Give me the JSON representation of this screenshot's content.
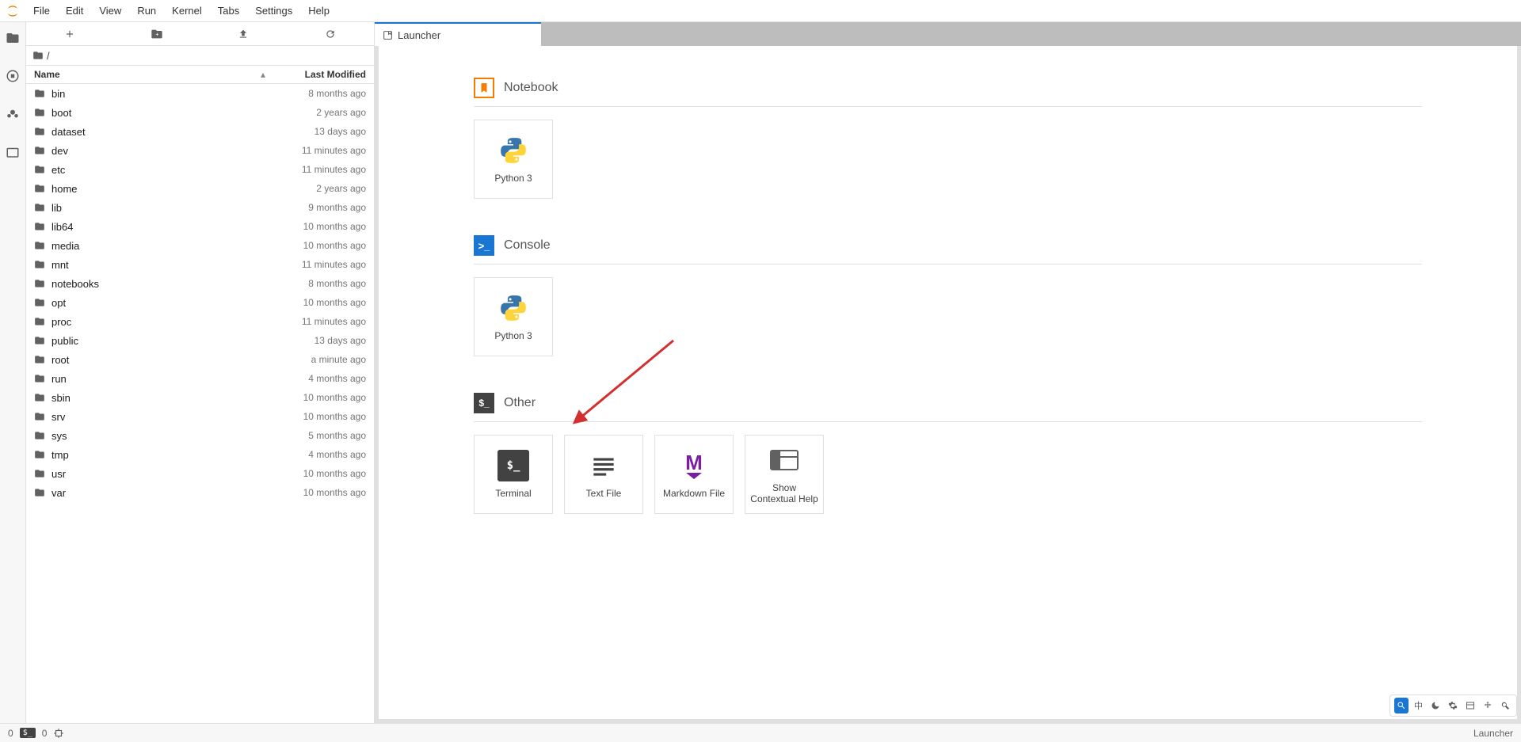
{
  "menu": [
    "File",
    "Edit",
    "View",
    "Run",
    "Kernel",
    "Tabs",
    "Settings",
    "Help"
  ],
  "breadcrumb": {
    "root": "/"
  },
  "file_header": {
    "name": "Name",
    "last_modified": "Last Modified"
  },
  "files": [
    {
      "name": "bin",
      "modified": "8 months ago"
    },
    {
      "name": "boot",
      "modified": "2 years ago"
    },
    {
      "name": "dataset",
      "modified": "13 days ago"
    },
    {
      "name": "dev",
      "modified": "11 minutes ago"
    },
    {
      "name": "etc",
      "modified": "11 minutes ago"
    },
    {
      "name": "home",
      "modified": "2 years ago"
    },
    {
      "name": "lib",
      "modified": "9 months ago"
    },
    {
      "name": "lib64",
      "modified": "10 months ago"
    },
    {
      "name": "media",
      "modified": "10 months ago"
    },
    {
      "name": "mnt",
      "modified": "11 minutes ago"
    },
    {
      "name": "notebooks",
      "modified": "8 months ago"
    },
    {
      "name": "opt",
      "modified": "10 months ago"
    },
    {
      "name": "proc",
      "modified": "11 minutes ago"
    },
    {
      "name": "public",
      "modified": "13 days ago"
    },
    {
      "name": "root",
      "modified": "a minute ago"
    },
    {
      "name": "run",
      "modified": "4 months ago"
    },
    {
      "name": "sbin",
      "modified": "10 months ago"
    },
    {
      "name": "srv",
      "modified": "10 months ago"
    },
    {
      "name": "sys",
      "modified": "5 months ago"
    },
    {
      "name": "tmp",
      "modified": "4 months ago"
    },
    {
      "name": "usr",
      "modified": "10 months ago"
    },
    {
      "name": "var",
      "modified": "10 months ago"
    }
  ],
  "tab": {
    "title": "Launcher"
  },
  "launcher": {
    "notebook": {
      "title": "Notebook",
      "card_label": "Python 3"
    },
    "console": {
      "title": "Console",
      "card_label": "Python 3"
    },
    "other": {
      "title": "Other",
      "terminal": "Terminal",
      "textfile": "Text File",
      "markdown": "Markdown File",
      "contextual": "Show Contextual Help"
    }
  },
  "status": {
    "left_count1": "0",
    "left_count2": "0",
    "right_label": "Launcher"
  },
  "right_toolbar": [
    "中"
  ]
}
